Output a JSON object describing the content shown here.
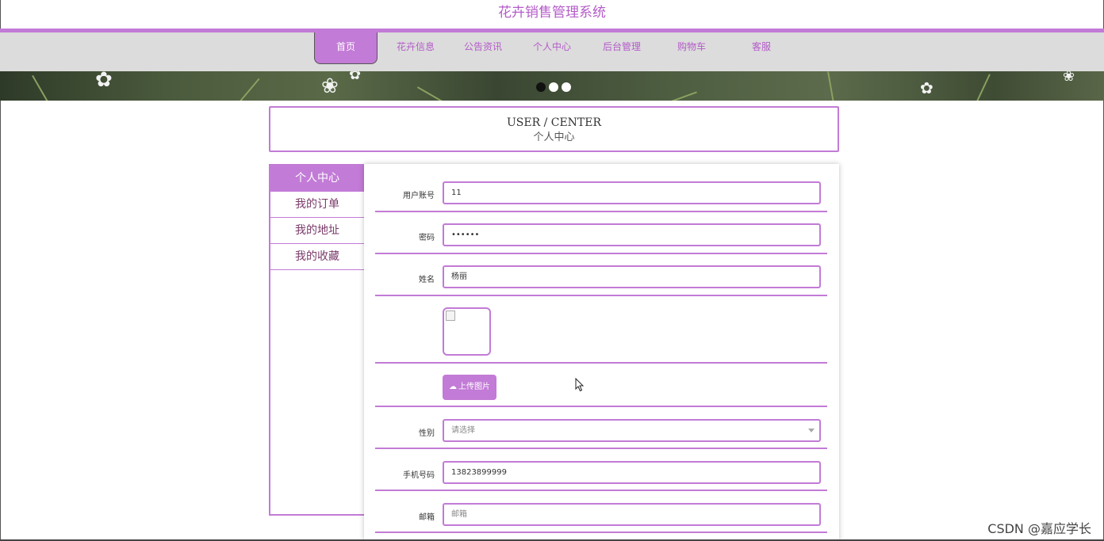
{
  "site": {
    "title": "花卉销售管理系统"
  },
  "nav": {
    "items": [
      {
        "label": "首页",
        "active": true
      },
      {
        "label": "花卉信息"
      },
      {
        "label": "公告资讯"
      },
      {
        "label": "个人中心"
      },
      {
        "label": "后台管理"
      },
      {
        "label": "购物车"
      },
      {
        "label": "客服"
      }
    ]
  },
  "banner": {
    "dots": 3,
    "active_dot": 1
  },
  "user_center": {
    "title_en": "USER / CENTER",
    "title_cn": "个人中心"
  },
  "sidebar": {
    "items": [
      {
        "label": "个人中心",
        "active": true
      },
      {
        "label": "我的订单"
      },
      {
        "label": "我的地址"
      },
      {
        "label": "我的收藏"
      }
    ]
  },
  "form": {
    "account": {
      "label": "用户账号",
      "value": "11"
    },
    "password": {
      "label": "密码",
      "value": "••••••"
    },
    "name": {
      "label": "姓名",
      "value": "杨丽"
    },
    "upload_label": "上传图片",
    "gender": {
      "label": "性别",
      "placeholder": "请选择"
    },
    "phone": {
      "label": "手机号码",
      "value": "13823899999"
    },
    "email": {
      "label": "邮箱",
      "placeholder": "邮箱"
    }
  },
  "watermark": "CSDN @嘉应学长",
  "colors": {
    "accent": "#c27bd6",
    "accent_text": "#b45cc9",
    "nav_bg": "#dcdcdc"
  }
}
